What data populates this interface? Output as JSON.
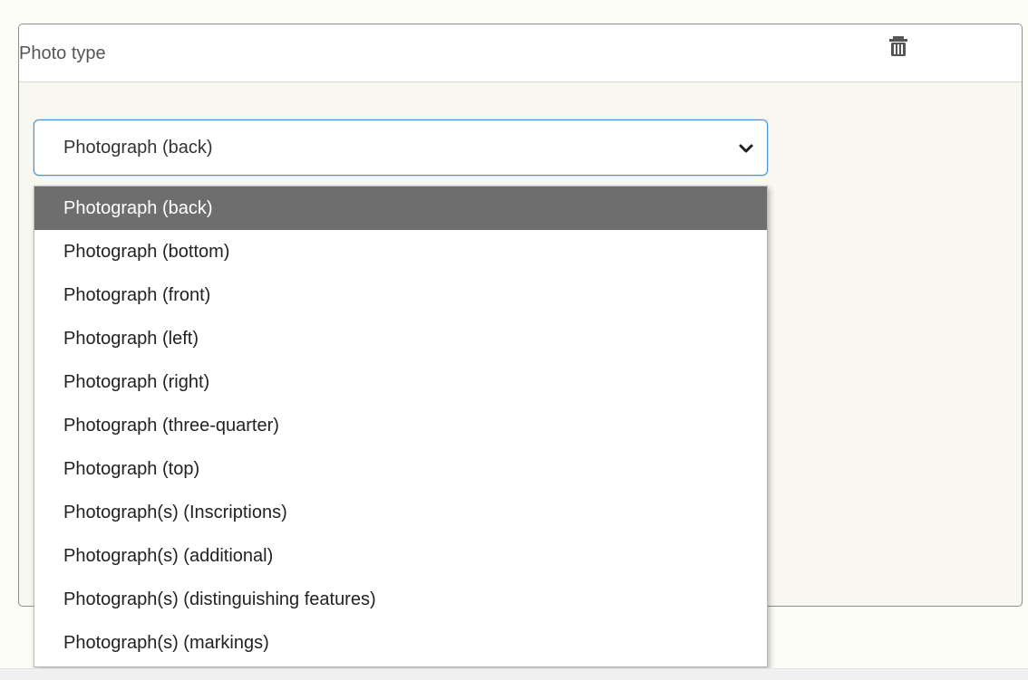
{
  "panel": {
    "title": "Photo type",
    "delete_icon": "trash-icon"
  },
  "select": {
    "selected": "Photograph (back)",
    "chevron_icon": "chevron-down-icon"
  },
  "dropdown": {
    "options": [
      "Photograph (back)",
      "Photograph (bottom)",
      "Photograph (front)",
      "Photograph (left)",
      "Photograph (right)",
      "Photograph (three-quarter)",
      "Photograph (top)",
      "Photograph(s) (Inscriptions)",
      "Photograph(s) (additional)",
      "Photograph(s) (distinguishing features)",
      "Photograph(s) (markings)"
    ],
    "highlighted": "Photograph (back)"
  },
  "colors": {
    "highlight": "#6e6e6e",
    "focus_border": "#4c92d6",
    "panel_bg": "#f8f8f0"
  }
}
